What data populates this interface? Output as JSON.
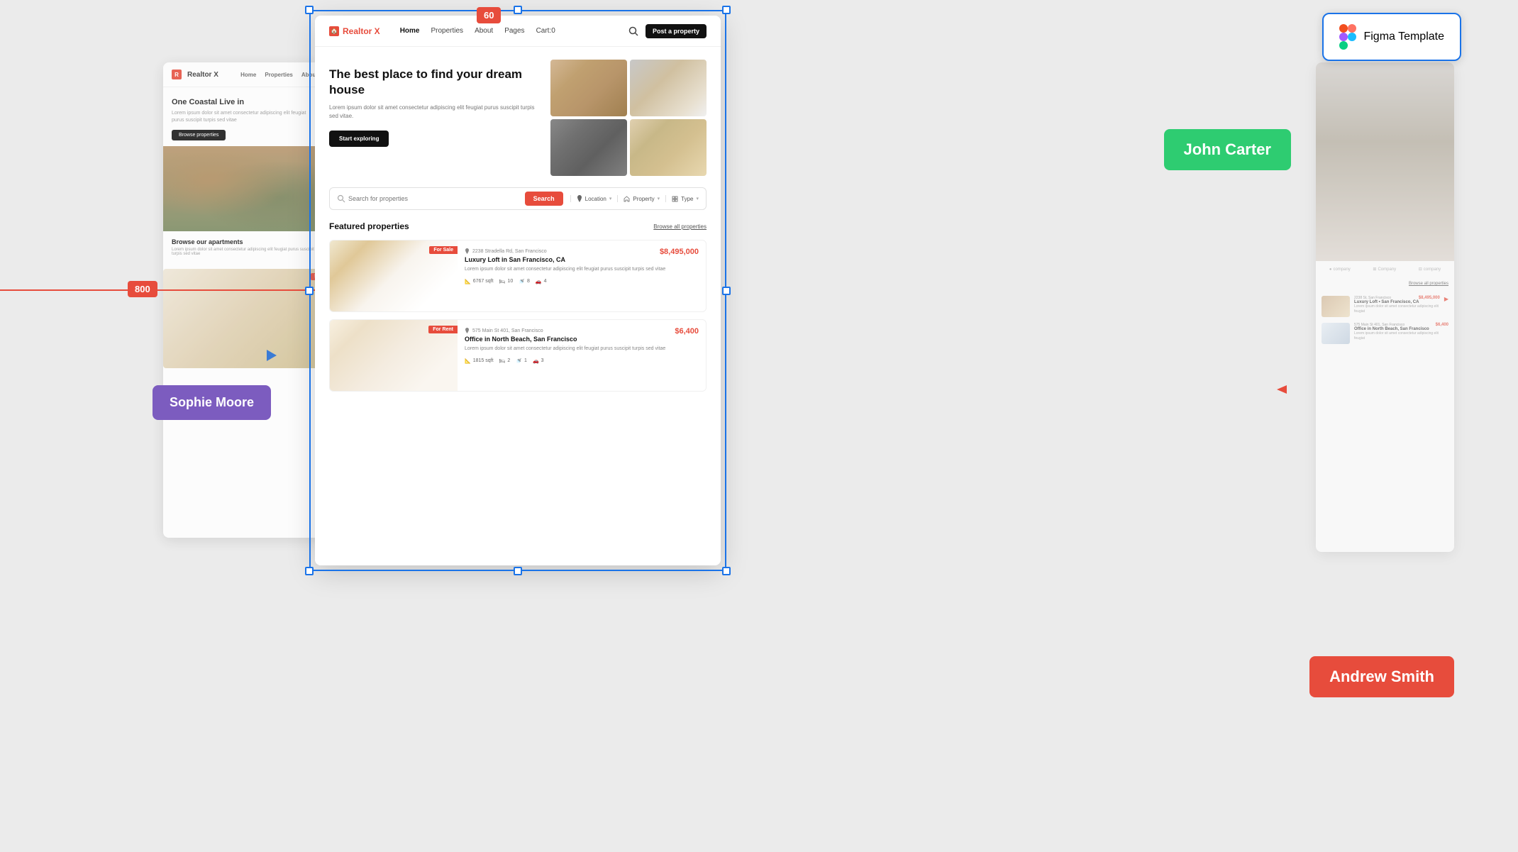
{
  "canvas": {
    "background": "#ebebeb"
  },
  "badge_60": "60",
  "badge_800": "800",
  "figma_badge": {
    "text": "Figma Template"
  },
  "john_carter": "John Carter",
  "sophie_moore": "Sophie Moore",
  "andrew_smith": "Andrew Smith",
  "navbar": {
    "logo": "Realtor X",
    "links": [
      "Home",
      "Properties",
      "About",
      "Pages",
      "Cart:0"
    ],
    "post_button": "Post a property"
  },
  "hero": {
    "title": "The best place to find your dream house",
    "body": "Lorem ipsum dolor sit amet consectetur adipiscing elit feugiat purus suscipit turpis sed vitae.",
    "cta": "Start exploring"
  },
  "search": {
    "placeholder": "Search for properties",
    "button": "Search",
    "filters": {
      "location_label": "Location",
      "property_label": "Property",
      "type_label": "Type"
    }
  },
  "featured": {
    "title": "Featured properties",
    "browse_all": "Browse all properties",
    "properties": [
      {
        "badge": "For Sale",
        "badge_type": "sale",
        "address": "2238 Stradella Rd, San Francisco",
        "price": "$8,495,000",
        "name": "Luxury Loft in San Francisco, CA",
        "desc": "Lorem ipsum dolor sit amet consectetur adipiscing elit feugiat purus suscipit turpis sed vitae",
        "specs": {
          "sqft": "6767 sqft",
          "beds": "10",
          "baths": "8",
          "cars": "4"
        }
      },
      {
        "badge": "For Rent",
        "badge_type": "rent",
        "address": "575 Main St 401, San Francisco",
        "price": "$6,400",
        "name": "Office in North Beach, San Francisco",
        "desc": "Lorem ipsum dolor sit amet consectetur adipiscing elit feugiat purus suscipit turpis sed vitae",
        "specs": {
          "sqft": "1815 sqft",
          "beds": "2",
          "baths": "1",
          "cars": "3"
        }
      }
    ]
  },
  "left_card": {
    "logo": "Realtor X",
    "nav": [
      "Home",
      "Properties",
      "About"
    ],
    "hero_title": "One Coastal Live in",
    "hero_sub": "Lorem ipsum dolor sit amet consectetur adipiscing elit feugiat purus suscipit turpis sed vitae",
    "btn": "Browse properties",
    "browse_title": "Browse our apartments",
    "browse_sub": "Lorem ipsum dolor sit amet consectetur adipiscing elit feugiat purus suscipit turpis sed vitae"
  },
  "right_ghost": {
    "browse_all": "Browse all properties",
    "prop1": {
      "address": "2238 St, San Francisco",
      "price": "$8,495,000",
      "name": "Luxury Loft • San Francisco, CA",
      "desc": "Lorem ipsum dolor sit amet consectetur adipiscing elit feugiat"
    },
    "prop2": {
      "address": "575 Main St 401, San Francisco",
      "price": "$6,400",
      "name": "Office in North Beach, San Francisco",
      "desc": "Lorem ipsum dolor sit amet consectetur adipiscing elit feugiat"
    },
    "companies": [
      "company",
      "Company",
      "company"
    ]
  },
  "icons": {
    "search": "🔍",
    "location": "📍",
    "home": "🏠",
    "bed": "🛏",
    "bath": "🚿",
    "car": "🚗",
    "sqft": "📐",
    "chevron": "›",
    "arrow_left": "◀",
    "arrow_right": "▶"
  }
}
